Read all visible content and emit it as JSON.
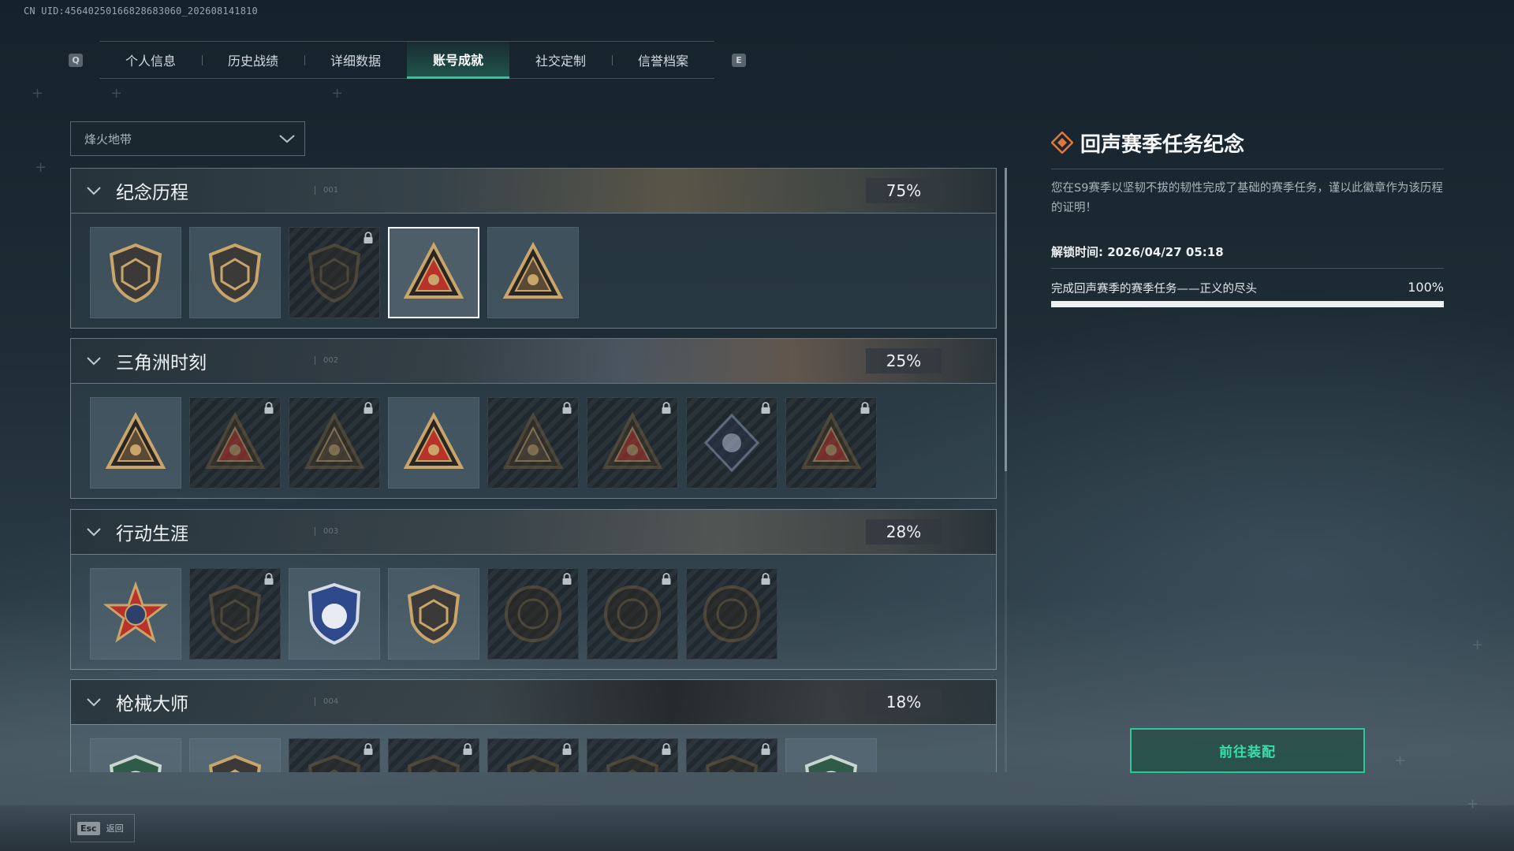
{
  "header": {
    "uid": "CN UID:456402501668286830​60_202608141810"
  },
  "tabs": {
    "left_key": "Q",
    "right_key": "E",
    "items": [
      {
        "label": "个人信息"
      },
      {
        "label": "历史战绩"
      },
      {
        "label": "详细数据"
      },
      {
        "label": "账号成就"
      },
      {
        "label": "社交定制"
      },
      {
        "label": "信誉档案"
      }
    ],
    "active_index": 3
  },
  "mode_dropdown": {
    "value": "烽火地带"
  },
  "sections": [
    {
      "title": "纪念历程",
      "number": "001",
      "percent": "75%",
      "badge_count": 5,
      "locked": [
        2
      ],
      "selected": 3
    },
    {
      "title": "三角洲时刻",
      "number": "002",
      "percent": "25%",
      "badge_count": 8,
      "locked": [
        1,
        2,
        4,
        5,
        6,
        7
      ]
    },
    {
      "title": "行动生涯",
      "number": "003",
      "percent": "28%",
      "badge_count": 7,
      "locked": [
        1,
        4,
        5,
        6
      ]
    },
    {
      "title": "枪械大师",
      "number": "004",
      "percent": "18%",
      "badge_count": 8,
      "locked": [
        2,
        3,
        4,
        5,
        6
      ]
    }
  ],
  "detail": {
    "title": "回声赛季任务纪念",
    "description": "您在S9赛季以坚韧不拔的韧性完成了基础的赛季任务，谨以此徽章作为该历程的证明！",
    "unlock_time": "解锁时间: 2026/04/27 05:18",
    "task": "完成回声赛季的赛季任务——正义的尽头",
    "task_percent": "100%",
    "task_progress": 1.0,
    "equip_button": "前往装配"
  },
  "footer": {
    "esc_key": "Esc",
    "esc_label": "返回"
  },
  "colors": {
    "accent": "#2ec79a",
    "badge_gold": "#c8a56a",
    "badge_red": "#b8322a",
    "badge_dark": "#6e5c3f"
  }
}
